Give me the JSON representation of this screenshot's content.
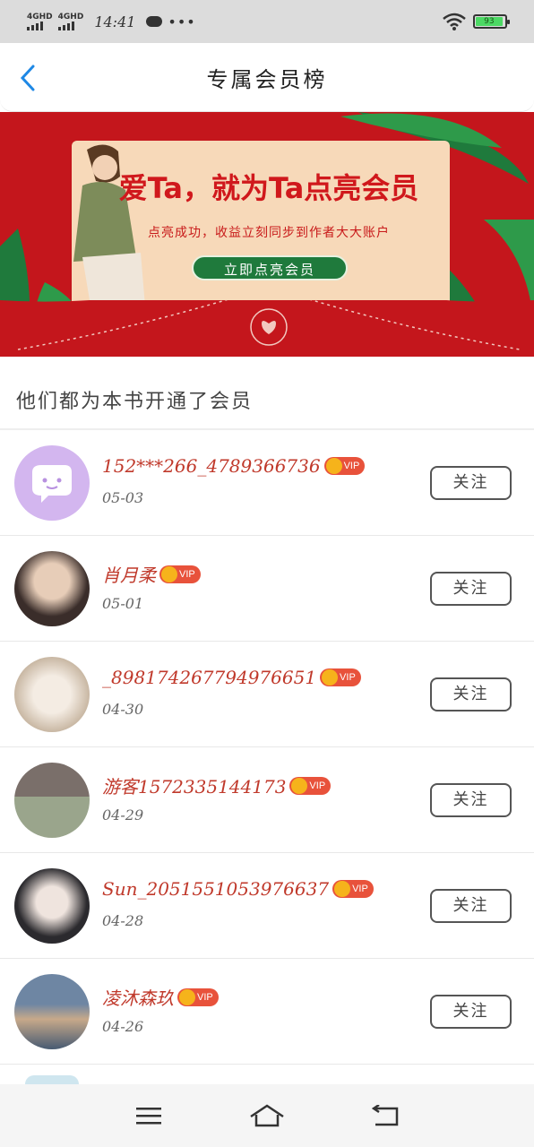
{
  "status_bar": {
    "network1": "4GHD",
    "network2": "4GHD",
    "time": "14:41",
    "more": "•••",
    "battery": "93"
  },
  "header": {
    "title": "专属会员榜",
    "back_icon": "chevron-left-icon"
  },
  "banner": {
    "headline": "爱Ta，就为Ta点亮会员",
    "subtitle": "点亮成功，收益立刻同步到作者大大账户",
    "cta_label": "立即点亮会员",
    "bg_color": "#c4161c",
    "cta_color": "#1f7a3c"
  },
  "section": {
    "title": "他们都为本书开通了会员"
  },
  "members": [
    {
      "name": "152***266_4789366736",
      "date": "05-03",
      "vip": "VIP",
      "follow": "关注"
    },
    {
      "name": "肖月柔",
      "date": "05-01",
      "vip": "VIP",
      "follow": "关注"
    },
    {
      "name": "_898174267794976651",
      "date": "04-30",
      "vip": "VIP",
      "follow": "关注"
    },
    {
      "name": "游客1572335144173",
      "date": "04-29",
      "vip": "VIP",
      "follow": "关注"
    },
    {
      "name": "Sun_2051551053976637",
      "date": "04-28",
      "vip": "VIP",
      "follow": "关注"
    },
    {
      "name": "凌沐森玖",
      "date": "04-26",
      "vip": "VIP",
      "follow": "关注"
    }
  ],
  "colors": {
    "accent_blue": "#1e88e5",
    "name_red": "#c0392b",
    "vip_red": "#e8523b",
    "crown_gold": "#f6b31b"
  },
  "nav": {
    "menu_icon": "menu-icon",
    "home_icon": "home-icon",
    "back_icon": "back-arrow-icon"
  }
}
